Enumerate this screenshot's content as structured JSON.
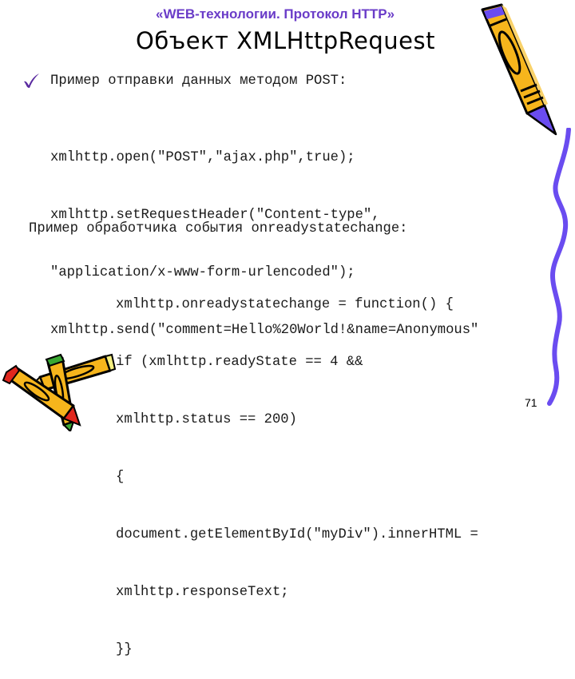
{
  "slide": {
    "subtitle": "«WEB-технологии. Протокол HTTP»",
    "title": "Объект XMLHttpRequest",
    "page_number": "71",
    "accent_color": "#6a3cc8"
  },
  "post_example": {
    "bullet_icon": "check-icon",
    "lead": "Пример отправки данных методом POST:",
    "code": [
      "xmlhttp.open(\"POST\",\"ajax.php\",true);",
      "xmlhttp.setRequestHeader(\"Content-type\",",
      "\"application/x-www-form-urlencoded\");",
      "xmlhttp.send(\"comment=Hello%20World!&name=Anonymous\"",
      ");"
    ]
  },
  "handler_example": {
    "lead": "Пример обработчика события onreadystatechange:",
    "code": [
      "xmlhttp.onreadystatechange = function() {",
      "if (xmlhttp.readyState == 4 &&",
      "xmlhttp.status == 200)",
      "{",
      "document.getElementById(\"myDiv\").innerHTML =",
      "xmlhttp.responseText;",
      "}}"
    ]
  },
  "decorations": {
    "top_right": "pencil-icon",
    "bottom_left": "crossed-pencils-icon",
    "right_edge": "wavy-line"
  }
}
